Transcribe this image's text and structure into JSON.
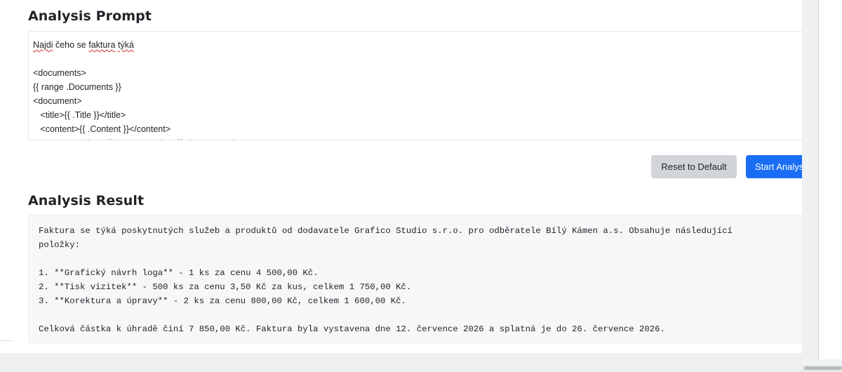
{
  "prompt_section": {
    "title": "Analysis Prompt",
    "lines": [
      {
        "parts": [
          {
            "text": "Najdi",
            "spell": true
          },
          {
            "text": " čeho se ",
            "spell": false
          },
          {
            "text": "faktura",
            "spell": true
          },
          {
            "text": " ",
            "spell": false
          },
          {
            "text": "týká",
            "spell": true
          }
        ]
      },
      {
        "parts": [
          {
            "text": "",
            "spell": false
          }
        ]
      },
      {
        "parts": [
          {
            "text": "<documents>",
            "spell": false
          }
        ]
      },
      {
        "parts": [
          {
            "text": "{{ range .Documents }}",
            "spell": false
          }
        ]
      },
      {
        "parts": [
          {
            "text": "<document>",
            "spell": false
          }
        ]
      },
      {
        "parts": [
          {
            "text": "   <title>{{ .Title }}</title>",
            "spell": false
          }
        ]
      },
      {
        "parts": [
          {
            "text": "   <content>{{ .Content }}</content>",
            "spell": false
          }
        ]
      },
      {
        "parts": [
          {
            "text": "   <correspondent>{{ .Correspondent }}</correspondent>",
            "spell": false
          }
        ]
      }
    ]
  },
  "buttons": {
    "reset_label": "Reset to Default",
    "start_label": "Start Analys"
  },
  "result_section": {
    "title": "Analysis Result",
    "lines": [
      "Faktura se týká poskytnutých služeb a produktů od dodavatele Grafico Studio s.r.o. pro odběratele Bílý Kámen a.s. Obsahuje následující",
      "položky:",
      "",
      "1. **Grafický návrh loga** - 1 ks za cenu 4 500,00 Kč.",
      "2. **Tisk vizitek** - 500 ks za cenu 3,50 Kč za kus, celkem 1 750,00 Kč.",
      "3. **Korektura a úpravy** - 2 ks za cenu 800,00 Kč, celkem 1 600,00 Kč.",
      "",
      "Celková částka k úhradě činí 7 850,00 Kč. Faktura byla vystavena dne 12. července 2026 a splatná je do 26. července 2026."
    ]
  },
  "colors": {
    "primary": "#1a6ef5",
    "secondary": "#d1d4d8",
    "result_background": "#f6f7f8",
    "spellcheck_underline": "#d0312d"
  }
}
